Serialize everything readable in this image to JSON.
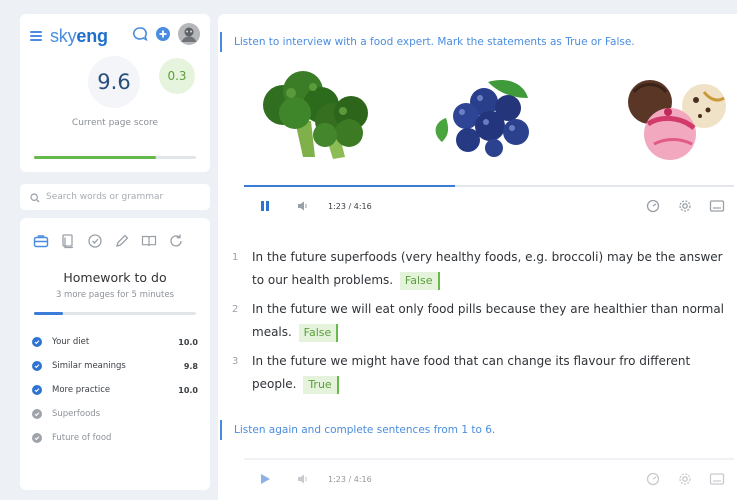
{
  "brand": {
    "part1": "sky",
    "part2": "eng"
  },
  "score": {
    "value": "9.6",
    "delta": "0.3",
    "label": "Current page score",
    "progress": 0.75
  },
  "search": {
    "placeholder": "Search words or grammar"
  },
  "homework": {
    "title": "Homework to do",
    "subtitle": "3 more pages for 5 minutes",
    "progress": 0.18,
    "tools": [
      "briefcase-icon",
      "pages-icon",
      "badge-icon",
      "pencil-icon",
      "book-icon",
      "refresh-icon"
    ],
    "lessons": [
      {
        "name": "Your diet",
        "score": "10.0",
        "done": true
      },
      {
        "name": "Similar meanings",
        "score": "9.8",
        "done": true
      },
      {
        "name": "More practice",
        "score": "10.0",
        "done": true
      },
      {
        "name": "Superfoods",
        "score": "",
        "done": false
      },
      {
        "name": "Future of food",
        "score": "",
        "done": false
      }
    ]
  },
  "exercise1": {
    "instruction": "Listen to interview with a food expert. Mark the statements as True or False.",
    "player": {
      "time": "1:23 / 4:16",
      "progress": 0.43
    },
    "statements": [
      {
        "num": "1",
        "text": "In the future superfoods (very healthy foods, e.g. broccoli) may be the answer to our health problems.",
        "answer": "False"
      },
      {
        "num": "2",
        "text": "In the future we will eat only food pills because they are healthier than normal meals.",
        "answer": "False"
      },
      {
        "num": "3",
        "text": "In the future we might have food that can change its flavour fro different people.",
        "answer": "True"
      }
    ]
  },
  "exercise2": {
    "instruction": "Listen again and complete sentences from 1 to 6.",
    "player": {
      "time": "1:23 / 4:16",
      "progress": 0
    }
  },
  "colors": {
    "accent": "#4a8de0",
    "success": "#65b84a",
    "answer_bg": "#e5f3dc"
  }
}
